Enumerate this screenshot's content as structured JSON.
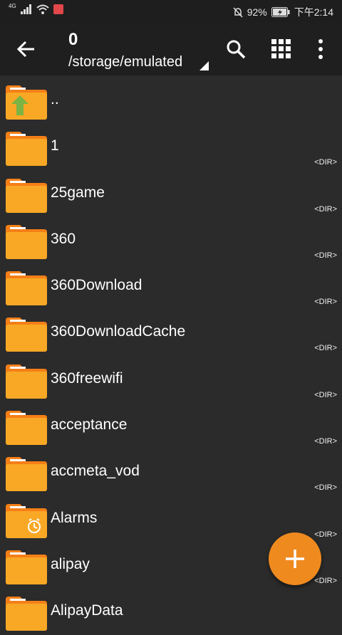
{
  "status_bar": {
    "network": "4G",
    "battery": "92%",
    "time": "下午2:14"
  },
  "toolbar": {
    "title": "0",
    "path": "/storage/emulated"
  },
  "files": [
    {
      "name": "..",
      "type": "parent",
      "badge": ""
    },
    {
      "name": "1",
      "type": "folder",
      "badge": "<DIR>"
    },
    {
      "name": "25game",
      "type": "folder",
      "badge": "<DIR>"
    },
    {
      "name": "360",
      "type": "folder",
      "badge": "<DIR>"
    },
    {
      "name": "360Download",
      "type": "folder",
      "badge": "<DIR>"
    },
    {
      "name": "360DownloadCache",
      "type": "folder",
      "badge": "<DIR>"
    },
    {
      "name": "360freewifi",
      "type": "folder",
      "badge": "<DIR>"
    },
    {
      "name": "acceptance",
      "type": "folder",
      "badge": "<DIR>"
    },
    {
      "name": "accmeta_vod",
      "type": "folder",
      "badge": "<DIR>"
    },
    {
      "name": "Alarms",
      "type": "alarm-folder",
      "badge": "<DIR>"
    },
    {
      "name": "alipay",
      "type": "folder",
      "badge": "<DIR>"
    },
    {
      "name": "AlipayData",
      "type": "folder",
      "badge": ""
    }
  ],
  "colors": {
    "folder_main": "#f9a825",
    "folder_back": "#f57f17",
    "fab": "#ef8a1f",
    "parent_arrow": "#7cb342"
  }
}
